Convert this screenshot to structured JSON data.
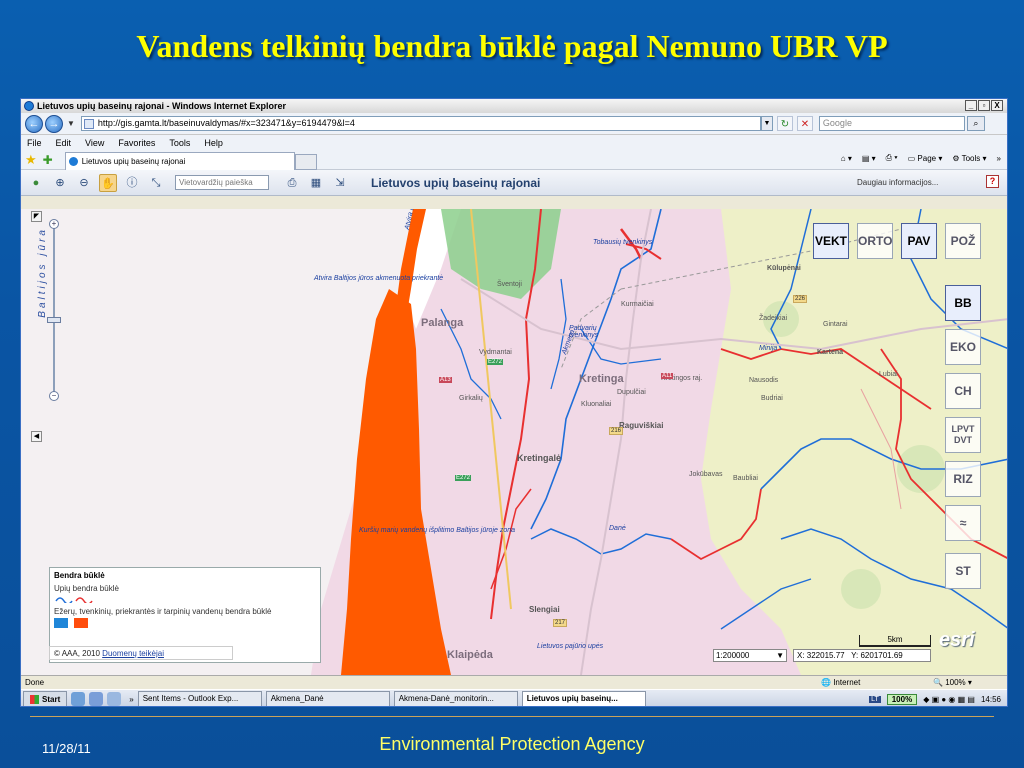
{
  "slide": {
    "title": "Vandens telkinių bendra būklė pagal Nemuno UBR VP",
    "date": "11/28/11",
    "footer": "Environmental Protection Agency"
  },
  "window": {
    "title": "Lietuvos upių baseinų rajonai - Windows Internet Explorer",
    "buttons": [
      "_",
      "▫",
      "X"
    ]
  },
  "address": {
    "url": "http://gis.gamta.lt/baseinuvaldymas/#x=323471&y=6194479&l=4",
    "search_placeholder": "Google"
  },
  "menu": [
    "File",
    "Edit",
    "View",
    "Favorites",
    "Tools",
    "Help"
  ],
  "tab": {
    "label": "Lietuvos upių baseinų rajonai"
  },
  "command_bar": {
    "page": "Page",
    "tools": "Tools"
  },
  "app": {
    "title": "Lietuvos upių baseinų rajonai",
    "search_placeholder": "Vietovardžių paieška",
    "more_info": "Daugiau informacijos...",
    "help": "?"
  },
  "map": {
    "sea_label": "Baltijos jūra",
    "layers": [
      "VEKT",
      "ORTO",
      "PAV",
      "POŽ"
    ],
    "side_layers": [
      "BB",
      "EKO",
      "CH",
      "LPVT DVT",
      "RIZ",
      "",
      "ST"
    ],
    "labels": {
      "palanga": "Palanga",
      "kretinga": "Kretinga",
      "kretingale": "Kretingalė",
      "klaipeda": "Klaipėda",
      "slengiai": "Slengiai",
      "raguviskiai": "Raguviškiai",
      "kulupenai": "Kūlupėnai",
      "sventoji": "Šventoji",
      "tobausiu": "Tobausių tvenkinys",
      "padvariu": "Padvarių tvenkinys",
      "vydmantai": "Vydmantai",
      "kretingos": "Kretingos raj.",
      "girkaliai": "Girkalių",
      "open_sea": "Atvira Baltijos jūros akmenuota priekrantė",
      "open_sea_short": "Atvira Baltijos",
      "lagoon": "Kuršių marių vandenų išplitimo Baltijos jūroje zona",
      "minija": "Minija",
      "akmena": "Akmena",
      "dane": "Danė",
      "pajurio": "Lietuvos pajūrio upės",
      "zadeikiai": "Žadeikiai",
      "nausodis": "Nausodis",
      "budriai": "Budriai",
      "lubiai": "Lubiai",
      "kurmaiciai": "Kurmaičiai",
      "dupulciai": "Dupulčiai",
      "kluonaliai": "Kluonaliai",
      "jokubavas": "Jokūbavas",
      "baubliai": "Baubliai",
      "kartena": "Kartena",
      "gintarai": "Gintarai"
    },
    "roads": [
      "A13",
      "E272",
      "216",
      "226",
      "217",
      "A11",
      "E272"
    ]
  },
  "legend": {
    "title": "Bendra būklė",
    "rivers": "Upių bendra būklė",
    "lakes": "Ežerų, tvenkinių, priekrantės ir tarpinių vandenų bendra būklė",
    "copyright": "AAA, 2010",
    "link": "Duomenų teikėjai",
    "colors": {
      "good": "#1f86d8",
      "bad": "#ff4d0d"
    }
  },
  "scale": {
    "value": "1:200000",
    "bar": "5km"
  },
  "coords": {
    "x": "X: 322015.77",
    "y": "Y: 6201701.69"
  },
  "status": {
    "left": "Done",
    "zone": "Internet",
    "zoom": "100%"
  },
  "taskbar": {
    "start": "Start",
    "tasks": [
      "Sent Items - Outlook Exp...",
      "Akmena_Danė",
      "Akmena-Danė_monitorin...",
      "Lietuvos upių baseinų..."
    ],
    "lang": "LT",
    "zoom": "100%",
    "time": "14:56"
  }
}
